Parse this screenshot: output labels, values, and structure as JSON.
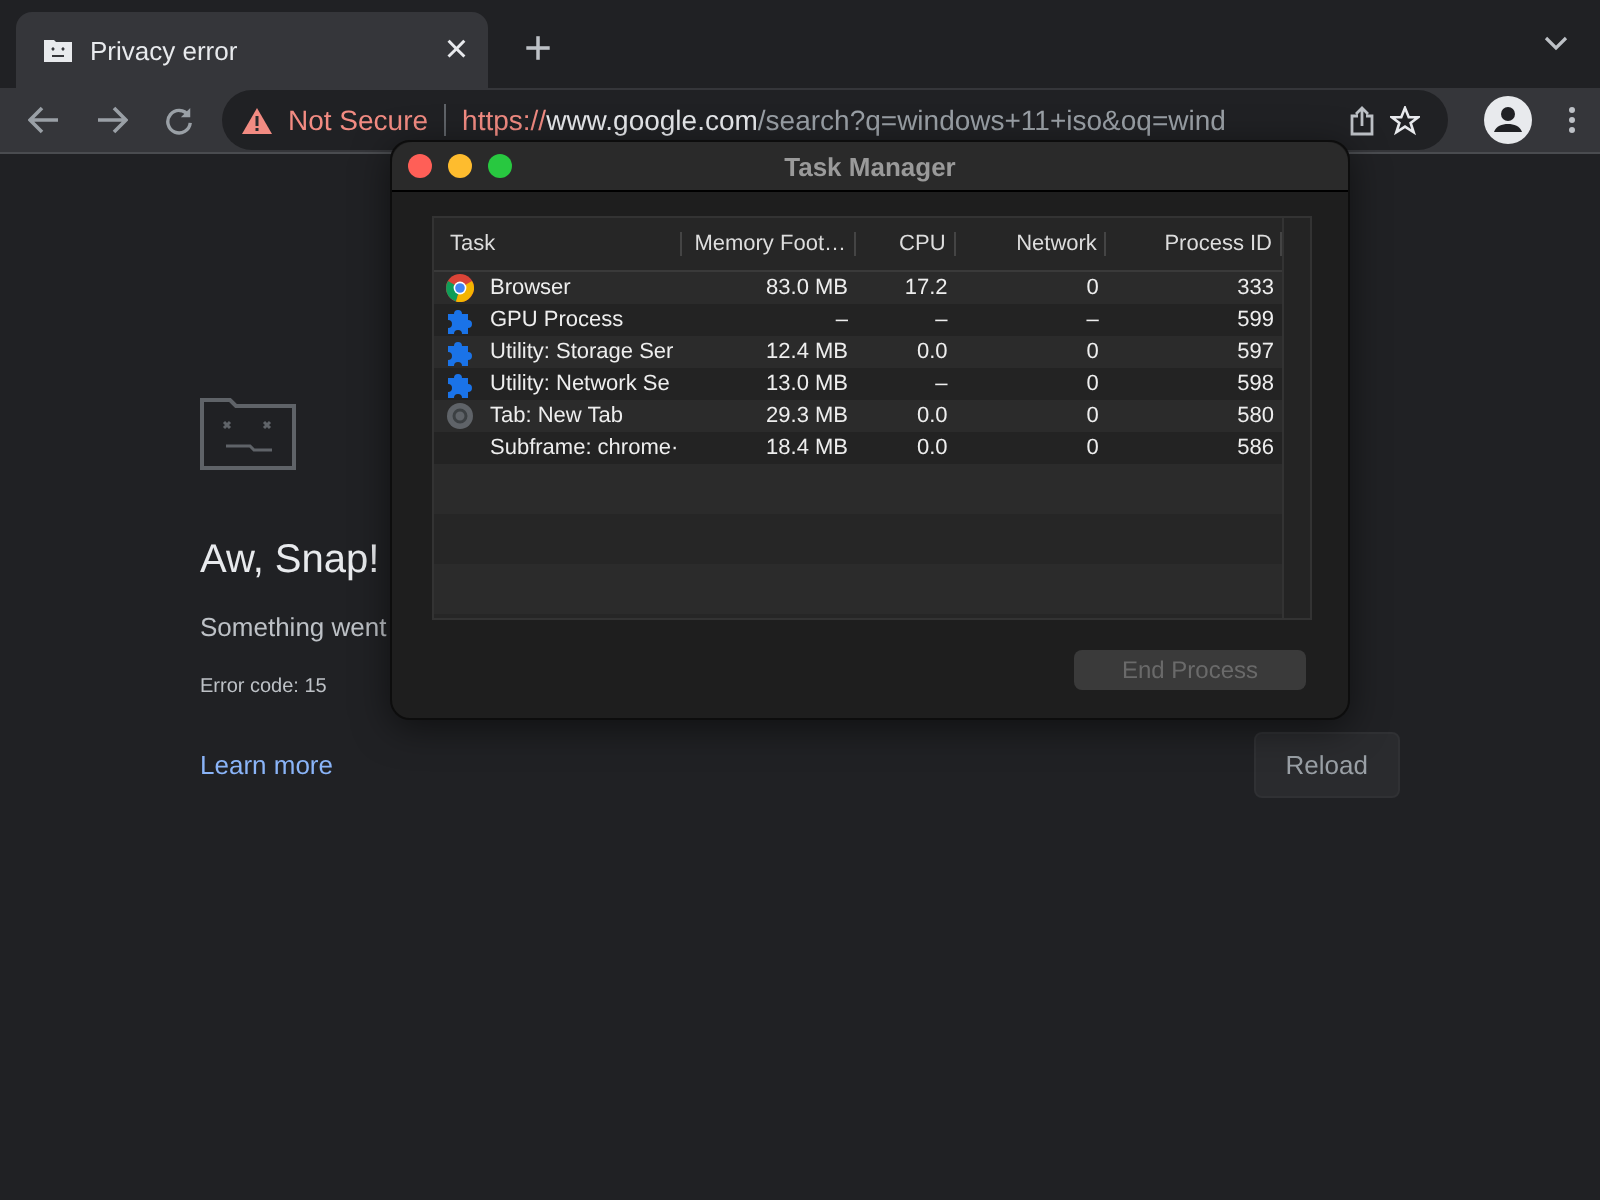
{
  "tab": {
    "title": "Privacy error",
    "close": "×",
    "new_tab": "+"
  },
  "toolbar": {
    "security": "Not Secure",
    "url_scheme": "https://",
    "url_host": "www.google.com",
    "url_path": "/search?q=windows+11+iso&oq=wind"
  },
  "page": {
    "heading": "Aw, Snap!",
    "message": "Something went",
    "error_code": "Error code: 15",
    "link": "Learn more",
    "button": "Reload"
  },
  "task_manager": {
    "title": "Task Manager",
    "columns": [
      "Task",
      "Memory Foot…",
      "CPU",
      "Network",
      "Process ID"
    ],
    "rows": [
      {
        "kind": "chrome",
        "task": "Browser",
        "memory": "83.0 MB",
        "cpu": "17.2",
        "network": "0",
        "pid": "333"
      },
      {
        "kind": "extension",
        "task": "GPU Process",
        "memory": "–",
        "cpu": "–",
        "network": "–",
        "pid": "599"
      },
      {
        "kind": "extension",
        "task": "Utility: Storage Ser",
        "memory": "12.4 MB",
        "cpu": "0.0",
        "network": "0",
        "pid": "597"
      },
      {
        "kind": "extension",
        "task": "Utility: Network Se",
        "memory": "13.0 MB",
        "cpu": "–",
        "network": "0",
        "pid": "598"
      },
      {
        "kind": "tab",
        "task": "Tab: New Tab",
        "memory": "29.3 MB",
        "cpu": "0.0",
        "network": "0",
        "pid": "580"
      },
      {
        "kind": "none",
        "task": "Subframe: chrome·",
        "memory": "18.4 MB",
        "cpu": "0.0",
        "network": "0",
        "pid": "586"
      }
    ],
    "end_button": {
      "label": "End Process",
      "disabled": true
    }
  }
}
